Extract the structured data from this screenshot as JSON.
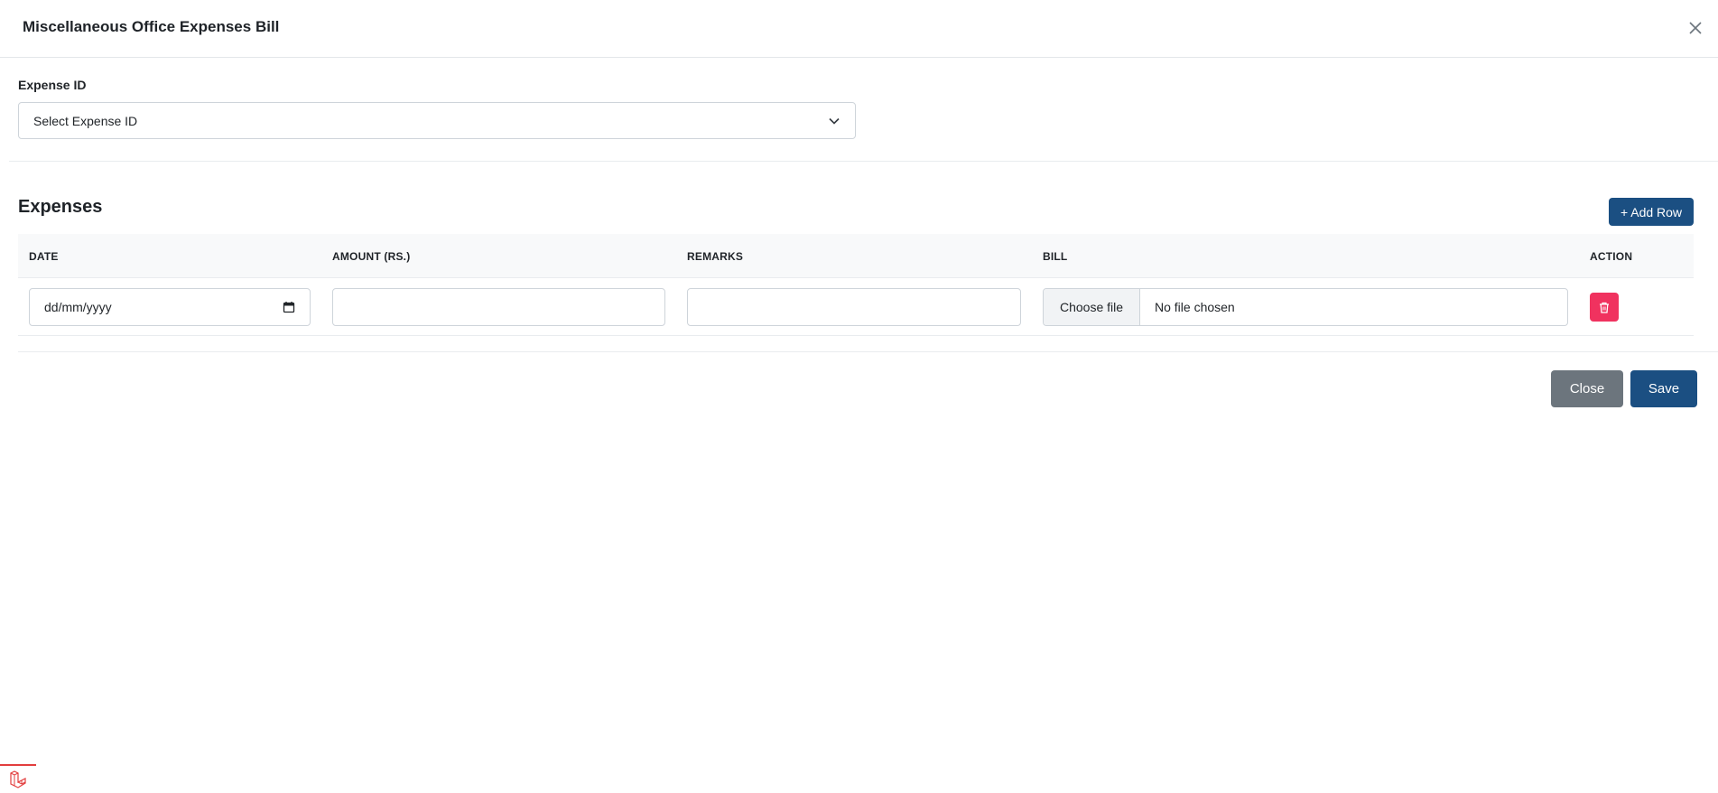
{
  "modal": {
    "title": "Miscellaneous Office Expenses Bill",
    "close_icon": "close-icon"
  },
  "expense_id": {
    "label": "Expense ID",
    "selected": "Select Expense ID",
    "icon": "chevron-down-icon"
  },
  "expenses": {
    "title": "Expenses",
    "add_row_label": "+ Add Row",
    "columns": [
      "DATE",
      "AMOUNT (RS.)",
      "REMARKS",
      "BILL",
      "ACTION"
    ],
    "rows": [
      {
        "date_placeholder": "dd/mm/yyyy",
        "amount": "",
        "remarks": "",
        "file_button": "Choose file",
        "file_name": "No file chosen",
        "action_icon": "trash-icon"
      }
    ]
  },
  "footer": {
    "close_label": "Close",
    "save_label": "Save"
  },
  "colors": {
    "primary": "#1b4f82",
    "secondary": "#6c757d",
    "danger": "#f0325f"
  },
  "corner_icon": "laravel-logo-icon"
}
